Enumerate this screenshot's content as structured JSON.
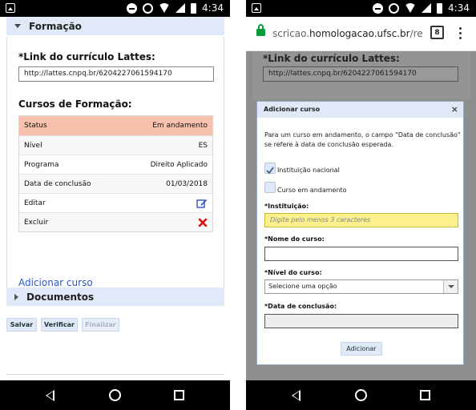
{
  "status_bar": {
    "time": "4:34"
  },
  "left": {
    "formacao_header": "Formação",
    "lattes_label": "*Link do currículo Lattes:",
    "lattes_value": "http://lattes.cnpq.br/6204227061594170",
    "cursos_label": "Cursos de Formação:",
    "course_rows": [
      {
        "label": "Status",
        "value": "Em andamento"
      },
      {
        "label": "Nível",
        "value": "ES"
      },
      {
        "label": "Programa",
        "value": "Direito Aplicado"
      },
      {
        "label": "Data de conclusão",
        "value": "01/03/2018"
      },
      {
        "label": "Editar",
        "icon": "edit-icon"
      },
      {
        "label": "Excluir",
        "icon": "delete-icon"
      }
    ],
    "add_course_link": "Adicionar curso",
    "documentos_header": "Documentos",
    "buttons": {
      "save": "Salvar",
      "verify": "Verificar",
      "finish": "Finalizar"
    }
  },
  "right": {
    "url_prefix": "scricao.",
    "url_domain": "homologacao.ufsc.br",
    "url_suffix": "/re",
    "tab_count": "8",
    "bg_lattes_label": "*Link do currículo Lattes:",
    "bg_lattes_value": "http://lattes.cnpq.br/6204227061594170",
    "modal": {
      "title": "Adicionar curso",
      "close": "×",
      "note": "Para um curso em andamento, o campo \"Data de conclusão\" se refere à data de conclusão esperada.",
      "cb_institution": "Instituição nacional",
      "cb_ongoing": "Curso em andamento",
      "institution_label": "*Instituição:",
      "institution_placeholder": "Digite pelo menos 3 caracteres",
      "course_name_label": "*Nome do curso:",
      "level_label": "*Nível do curso:",
      "level_select": "Selecione uma opção",
      "date_label": "*Data de conclusão:",
      "submit": "Adicionar"
    }
  }
}
